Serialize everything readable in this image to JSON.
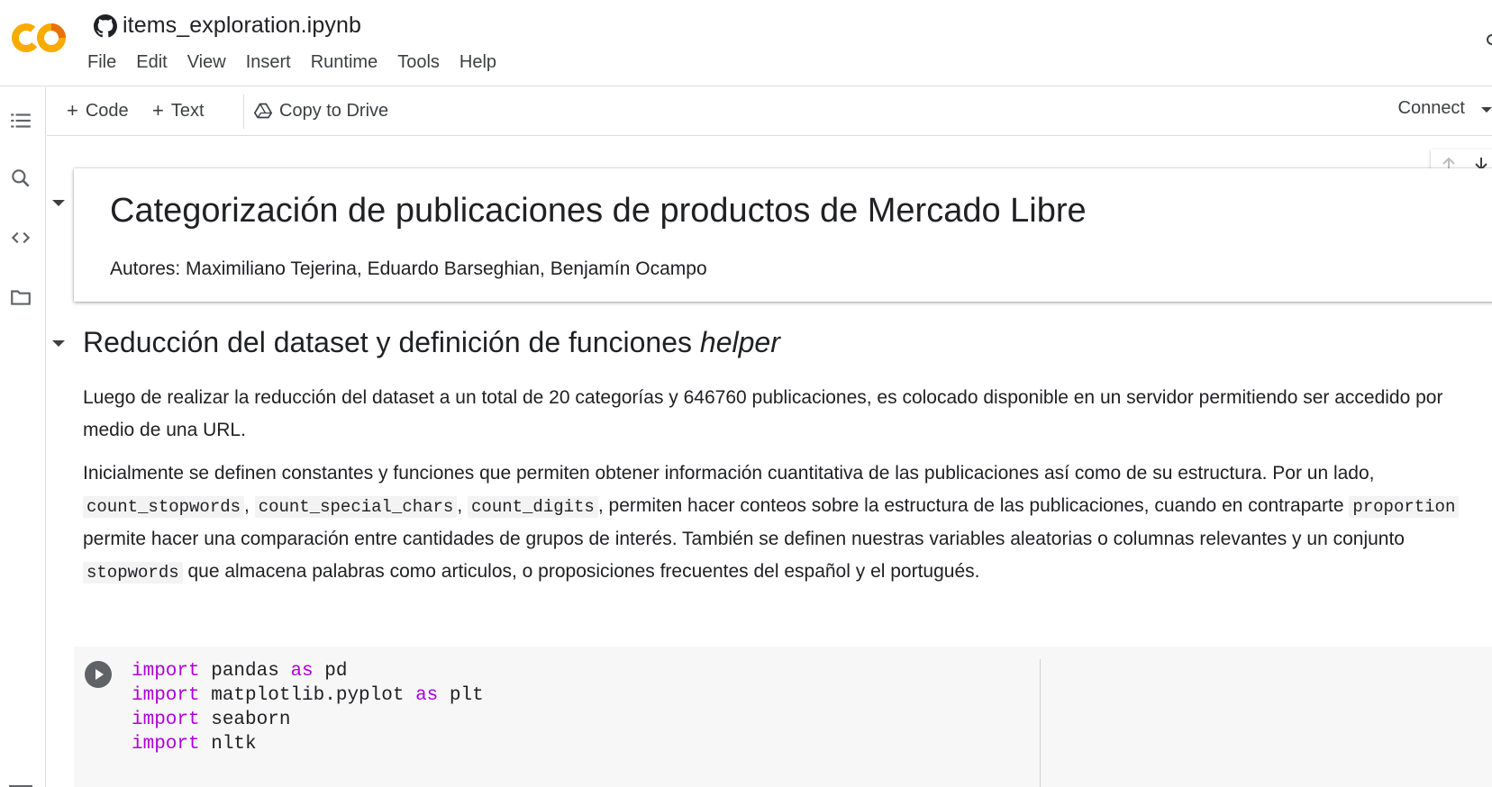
{
  "header": {
    "notebook_title": "items_exploration.ipynb",
    "menu": [
      "File",
      "Edit",
      "View",
      "Insert",
      "Runtime",
      "Tools",
      "Help"
    ]
  },
  "toolbar": {
    "code_label": "Code",
    "text_label": "Text",
    "copy_label": "Copy to Drive",
    "connect_label": "Connect"
  },
  "rail": {
    "icons": [
      "table-of-contents-icon",
      "search-icon",
      "code-snippets-icon",
      "folder-icon"
    ]
  },
  "cells": {
    "title": "Categorización de publicaciones de productos de Mercado Libre",
    "authors": "Autores: Maximiliano Tejerina, Eduardo Barseghian, Benjamín Ocampo",
    "section_heading": "Reducción del dataset y definición de funciones ",
    "section_heading_em": "helper",
    "para1": "Luego de realizar la reducción del dataset a un total de 20 categorías y 646760 publicaciones, es colocado disponible en un servidor permitiendo ser accedido por medio de una URL.",
    "para2": {
      "t1": "Inicialmente se definen constantes y funciones que permiten obtener información cuantitativa de las publicaciones así como de su estructura. Por un lado, ",
      "c1": "count_stopwords",
      "t2": ", ",
      "c2": "count_special_chars",
      "t3": ", ",
      "c3": "count_digits",
      "t4": ", permiten hacer conteos sobre la estructura de las publicaciones, cuando en contraparte ",
      "c4": "proportion",
      "t5": " permite hacer una comparación entre cantidades de grupos de interés. También se definen nuestras variables aleatorias o columnas relevantes y un conjunto ",
      "c5": "stopwords",
      "t6": " que almacena palabras como articulos, o proposiciones frecuentes del español y el portugués."
    },
    "code": [
      {
        "kw": "import",
        "rest": " pandas ",
        "kw2": "as",
        "rest2": " pd"
      },
      {
        "kw": "import",
        "rest": " matplotlib.pyplot ",
        "kw2": "as",
        "rest2": " plt"
      },
      {
        "kw": "import",
        "rest": " seaborn",
        "kw2": "",
        "rest2": ""
      },
      {
        "kw": "import",
        "rest": " nltk",
        "kw2": "",
        "rest2": ""
      }
    ]
  },
  "colors": {
    "keyword": "#af00db",
    "logo_orange": "#f9ab00",
    "logo_dark_orange": "#e8710a"
  }
}
